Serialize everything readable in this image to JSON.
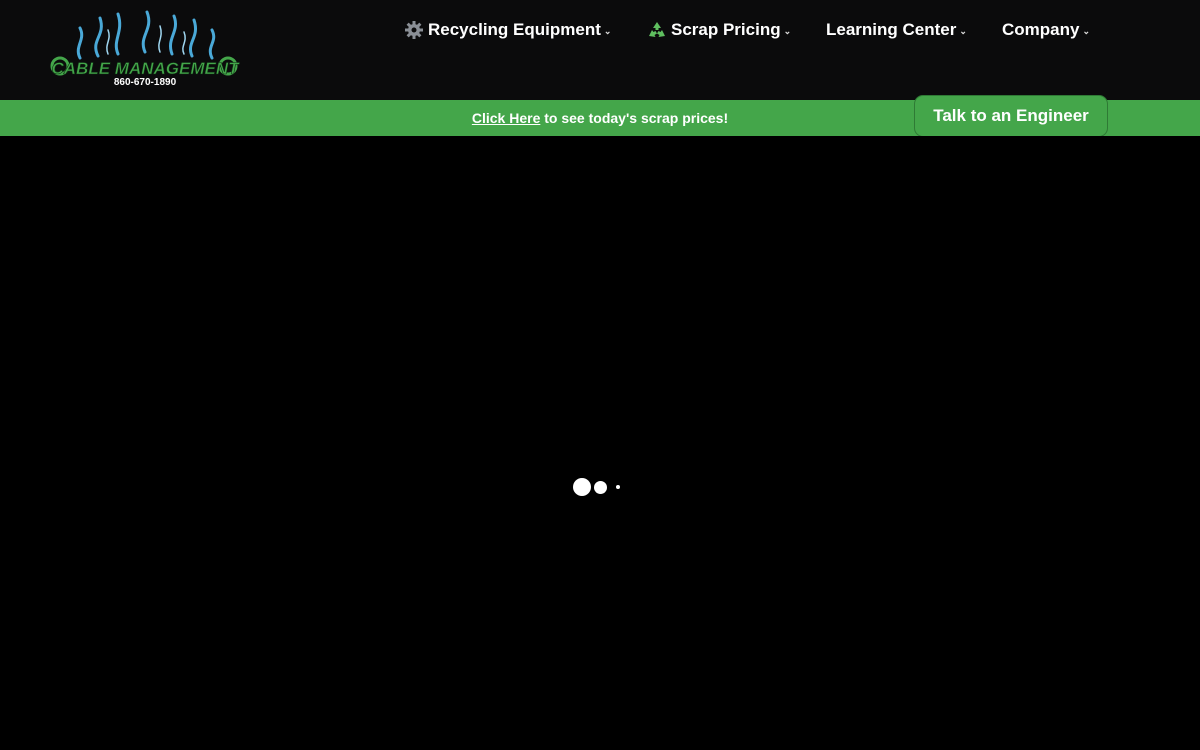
{
  "logo": {
    "brand_text": "CABLE MANAGEMENT",
    "phone": "860-670-1890"
  },
  "nav": {
    "items": [
      {
        "label": "Recycling Equipment",
        "icon": "gear-icon",
        "has_dropdown": true
      },
      {
        "label": "Scrap Pricing",
        "icon": "recycle-icon",
        "has_dropdown": true
      },
      {
        "label": "Learning Center",
        "icon": null,
        "has_dropdown": true
      },
      {
        "label": "Company",
        "icon": null,
        "has_dropdown": true
      }
    ],
    "chevron": "⌄"
  },
  "promo": {
    "link_text": "Click Here",
    "text": " to see today's scrap prices!"
  },
  "cta": {
    "label": "Talk to an Engineer"
  },
  "colors": {
    "header_bg": "#0b0b0c",
    "accent_green": "#44a64a",
    "page_bg": "#000000"
  }
}
